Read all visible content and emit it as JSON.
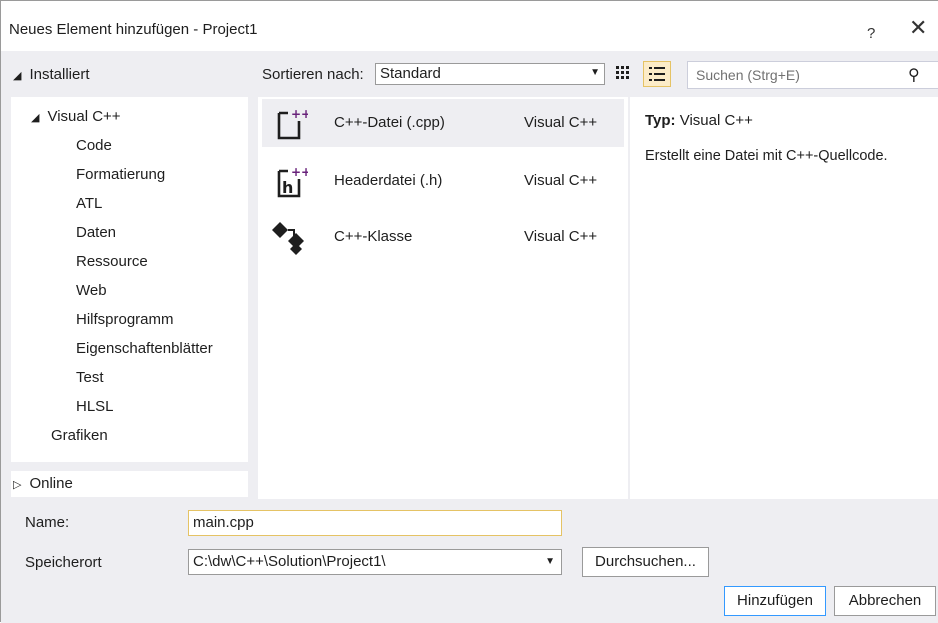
{
  "window": {
    "title": "Neues Element hinzufügen - Project1",
    "help": "?",
    "close": "✕"
  },
  "header": {
    "installed": "Installiert",
    "sort_label": "Sortieren nach:",
    "sort_value": "Standard",
    "search_placeholder": "Suchen (Strg+E)"
  },
  "tree": {
    "root": "Visual C++",
    "children": [
      "Code",
      "Formatierung",
      "ATL",
      "Daten",
      "Ressource",
      "Web",
      "Hilfsprogramm",
      "Eigenschaftenblätter",
      "Test",
      "HLSL"
    ],
    "other": "Grafiken",
    "online": "Online"
  },
  "templates": [
    {
      "name": "C++-Datei (.cpp)",
      "lang": "Visual C++",
      "icon": "cpp-file-icon",
      "selected": true
    },
    {
      "name": "Headerdatei (.h)",
      "lang": "Visual C++",
      "icon": "header-file-icon",
      "selected": false
    },
    {
      "name": "C++-Klasse",
      "lang": "Visual C++",
      "icon": "cpp-class-icon",
      "selected": false
    }
  ],
  "details": {
    "type_label": "Typ:",
    "type_value": "Visual C++",
    "description": "Erstellt eine Datei mit C++-Quellcode."
  },
  "form": {
    "name_label": "Name:",
    "name_value": "main.cpp",
    "location_label": "Speicherort",
    "location_value": "C:\\dw\\C++\\Solution\\Project1\\",
    "browse_label": "Durchsuchen...",
    "add_label": "Hinzufügen",
    "cancel_label": "Abbrechen"
  },
  "colors": {
    "accent_purple": "#68217a",
    "selection_bg": "#eeeef2",
    "dialog_bg": "#eeeef2",
    "focus_border": "#3399ff"
  }
}
